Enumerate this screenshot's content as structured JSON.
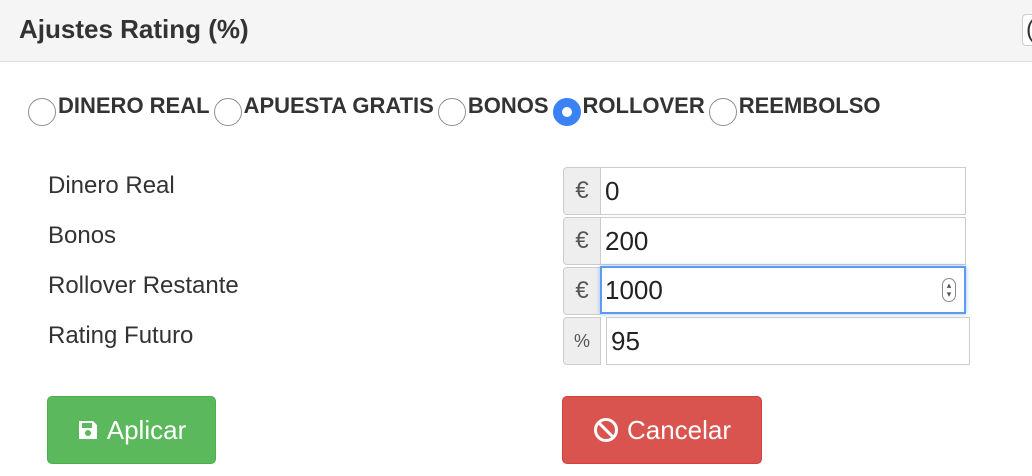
{
  "header": {
    "title": "Ajustes Rating (%)",
    "edge_char": "("
  },
  "radios": [
    {
      "label": "DINERO REAL",
      "checked": false
    },
    {
      "label": "APUESTA GRATIS",
      "checked": false
    },
    {
      "label": "BONOS",
      "checked": false
    },
    {
      "label": "ROLLOVER",
      "checked": true
    },
    {
      "label": "REEMBOLSO",
      "checked": false
    }
  ],
  "fields": {
    "dinero_real": {
      "label": "Dinero Real",
      "addon": "€",
      "value": "0"
    },
    "bonos": {
      "label": "Bonos",
      "addon": "€",
      "value": "200"
    },
    "rollover_restante": {
      "label": "Rollover Restante",
      "addon": "€",
      "value": "1000"
    },
    "rating_futuro": {
      "label": "Rating Futuro",
      "addon": "%",
      "value": "95"
    }
  },
  "buttons": {
    "apply": {
      "label": "Aplicar",
      "icon": "save-icon",
      "color": "#5cb85c"
    },
    "cancel": {
      "label": "Cancelar",
      "icon": "ban-icon",
      "color": "#d9534f"
    }
  },
  "colors": {
    "radio_selected": "#3b82f6",
    "focus_ring": "#5b9bf2"
  }
}
